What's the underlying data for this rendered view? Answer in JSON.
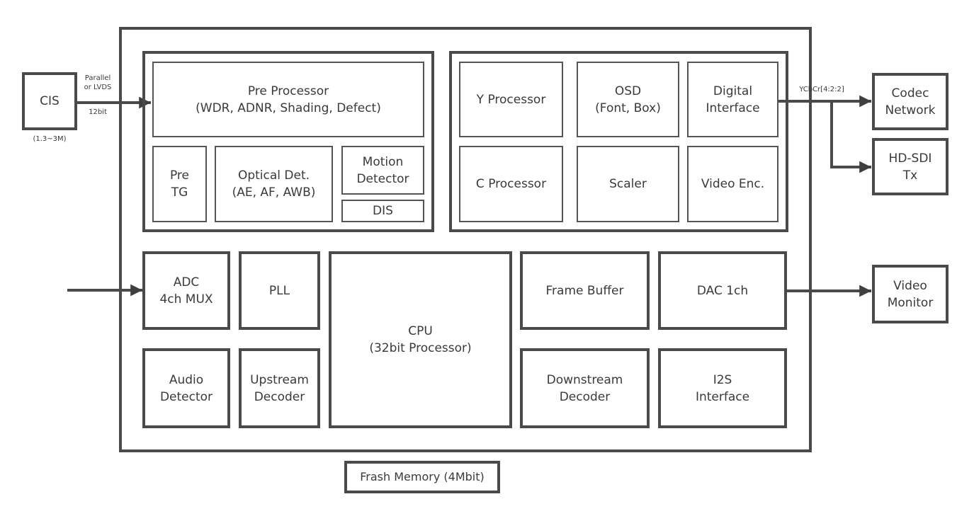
{
  "colors": {
    "stroke": "#4a4a4a",
    "text": "#3a3a3a",
    "background": "#ffffff"
  },
  "external": {
    "cis": "CIS",
    "cis_resolution": "(1.3~3M)",
    "cis_link_top": "Parallel\nor LVDS",
    "cis_link_bottom": "12bit",
    "ycbcr_label": "YCbCr[4:2:2]",
    "codec": "Codec\nNetwork",
    "hdsdi": "HD-SDI\nTx",
    "video_monitor": "Video\nMonitor",
    "flash": "Frash Memory (4Mbit)"
  },
  "pre_group": {
    "pre_processor": "Pre Processor\n(WDR, ADNR, Shading, Defect)",
    "pre_tg": "Pre\nTG",
    "optical": "Optical Det.\n(AE, AF, AWB)",
    "motion": "Motion\nDetector",
    "dis": "DIS"
  },
  "post_group": {
    "y_proc": "Y Processor",
    "osd": "OSD\n(Font, Box)",
    "digital": "Digital\nInterface",
    "c_proc": "C Processor",
    "scaler": "Scaler",
    "video_enc": "Video Enc."
  },
  "bottom": {
    "adc": "ADC\n4ch MUX",
    "pll": "PLL",
    "cpu": "CPU\n(32bit Processor)",
    "frame_buffer": "Frame Buffer",
    "dac": "DAC 1ch",
    "audio": "Audio\nDetector",
    "upstream": "Upstream\nDecoder",
    "downstream": "Downstream\nDecoder",
    "i2s": "I2S\nInterface"
  }
}
